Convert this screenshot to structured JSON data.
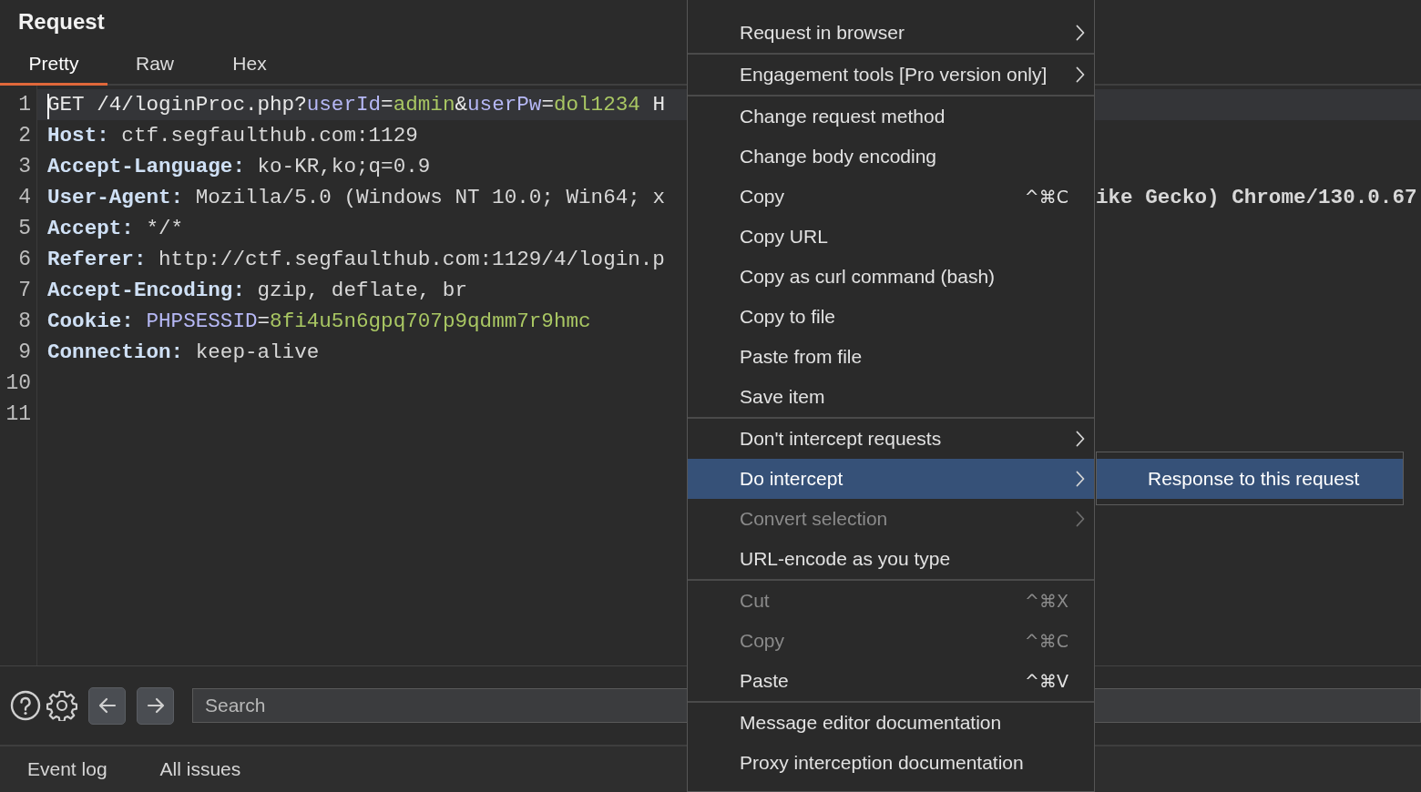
{
  "panel": {
    "title": "Request"
  },
  "tabs": [
    {
      "label": "Pretty",
      "selected": true
    },
    {
      "label": "Raw",
      "selected": false
    },
    {
      "label": "Hex",
      "selected": false
    }
  ],
  "editor": {
    "lines": [
      {
        "number": "1",
        "current": true,
        "tokens": [
          {
            "text": "GET /4/loginProc.php?",
            "kind": "plain"
          },
          {
            "text": "userId",
            "kind": "param"
          },
          {
            "text": "=",
            "kind": "plain"
          },
          {
            "text": "admin",
            "kind": "arg"
          },
          {
            "text": "&",
            "kind": "plain"
          },
          {
            "text": "userPw",
            "kind": "param"
          },
          {
            "text": "=",
            "kind": "plain"
          },
          {
            "text": "dol1234",
            "kind": "arg"
          },
          {
            "text": " H",
            "kind": "plain"
          }
        ]
      },
      {
        "number": "2",
        "current": false,
        "tokens": [
          {
            "text": "Host:",
            "kind": "key"
          },
          {
            "text": " ctf.segfaulthub.com:1129",
            "kind": "value"
          }
        ]
      },
      {
        "number": "3",
        "current": false,
        "tokens": [
          {
            "text": "Accept-Language:",
            "kind": "key"
          },
          {
            "text": " ko-KR,ko;q=0.9",
            "kind": "value"
          }
        ]
      },
      {
        "number": "4",
        "current": false,
        "tokens": [
          {
            "text": "User-Agent:",
            "kind": "key"
          },
          {
            "text": " Mozilla/5.0 (Windows NT 10.0; Win64; x",
            "kind": "value"
          }
        ],
        "tail": "ike Gecko) Chrome/130.0.67"
      },
      {
        "number": "5",
        "current": false,
        "tokens": [
          {
            "text": "Accept:",
            "kind": "key"
          },
          {
            "text": " */*",
            "kind": "value"
          }
        ]
      },
      {
        "number": "6",
        "current": false,
        "tokens": [
          {
            "text": "Referer:",
            "kind": "key"
          },
          {
            "text": " http://ctf.segfaulthub.com:1129/4/login.p",
            "kind": "value"
          }
        ]
      },
      {
        "number": "7",
        "current": false,
        "tokens": [
          {
            "text": "Accept-Encoding:",
            "kind": "key"
          },
          {
            "text": " gzip, deflate, br",
            "kind": "value"
          }
        ]
      },
      {
        "number": "8",
        "current": false,
        "tokens": [
          {
            "text": "Cookie:",
            "kind": "key"
          },
          {
            "text": " PHPSESSID",
            "kind": "param"
          },
          {
            "text": "=",
            "kind": "plain"
          },
          {
            "text": "8fi4u5n6gpq707p9qdmm7r9hmc",
            "kind": "arg"
          }
        ]
      },
      {
        "number": "9",
        "current": false,
        "tokens": [
          {
            "text": "Connection:",
            "kind": "key"
          },
          {
            "text": " keep-alive",
            "kind": "value"
          }
        ]
      },
      {
        "number": "10",
        "current": false
      },
      {
        "number": "11",
        "current": false
      }
    ]
  },
  "search": {
    "placeholder": "Search"
  },
  "bottom_tabs": [
    {
      "label": "Event log"
    },
    {
      "label": "All issues"
    }
  ],
  "context_menu": {
    "items": [
      {
        "kind": "item",
        "label": "Request in browser",
        "submenu": true,
        "disabled": false,
        "selected": false
      },
      {
        "kind": "separator"
      },
      {
        "kind": "item",
        "label": "Engagement tools [Pro version only]",
        "submenu": true,
        "disabled": false,
        "selected": false
      },
      {
        "kind": "separator"
      },
      {
        "kind": "item",
        "label": "Change request method",
        "submenu": false,
        "disabled": false,
        "selected": false
      },
      {
        "kind": "item",
        "label": "Change body encoding",
        "submenu": false,
        "disabled": false,
        "selected": false
      },
      {
        "kind": "item",
        "label": "Copy",
        "shortcut": "^⌘C",
        "submenu": false,
        "disabled": false,
        "selected": false
      },
      {
        "kind": "item",
        "label": "Copy URL",
        "submenu": false,
        "disabled": false,
        "selected": false
      },
      {
        "kind": "item",
        "label": "Copy as curl command (bash)",
        "submenu": false,
        "disabled": false,
        "selected": false
      },
      {
        "kind": "item",
        "label": "Copy to file",
        "submenu": false,
        "disabled": false,
        "selected": false
      },
      {
        "kind": "item",
        "label": "Paste from file",
        "submenu": false,
        "disabled": false,
        "selected": false
      },
      {
        "kind": "item",
        "label": "Save item",
        "submenu": false,
        "disabled": false,
        "selected": false
      },
      {
        "kind": "separator"
      },
      {
        "kind": "item",
        "label": "Don't intercept requests",
        "submenu": true,
        "disabled": false,
        "selected": false
      },
      {
        "kind": "item",
        "label": "Do intercept",
        "submenu": true,
        "disabled": false,
        "selected": true
      },
      {
        "kind": "item",
        "label": "Convert selection",
        "submenu": true,
        "disabled": true,
        "selected": false
      },
      {
        "kind": "item",
        "label": "URL-encode as you type",
        "submenu": false,
        "disabled": false,
        "selected": false
      },
      {
        "kind": "separator"
      },
      {
        "kind": "item",
        "label": "Cut",
        "shortcut": "^⌘X",
        "submenu": false,
        "disabled": true,
        "selected": false
      },
      {
        "kind": "item",
        "label": "Copy",
        "shortcut": "^⌘C",
        "submenu": false,
        "disabled": true,
        "selected": false
      },
      {
        "kind": "item",
        "label": "Paste",
        "shortcut": "^⌘V",
        "submenu": false,
        "disabled": false,
        "selected": false
      },
      {
        "kind": "separator"
      },
      {
        "kind": "item",
        "label": "Message editor documentation",
        "submenu": false,
        "disabled": false,
        "selected": false
      },
      {
        "kind": "item",
        "label": "Proxy interception documentation",
        "submenu": false,
        "disabled": false,
        "selected": false
      }
    ]
  },
  "submenu": {
    "items": [
      {
        "label": "Response to this request",
        "selected": true
      }
    ]
  }
}
